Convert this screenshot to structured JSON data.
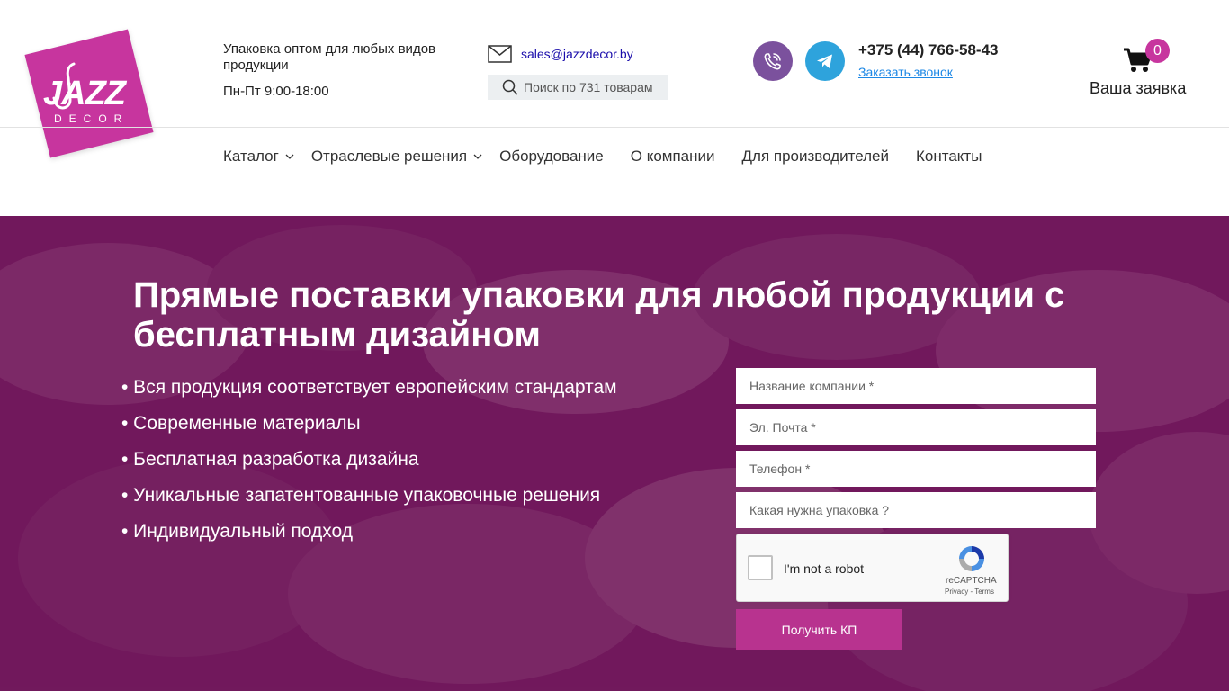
{
  "brand": {
    "logo_text": "JAZZ",
    "logo_subtext": "DECOR",
    "logo_color": "#c7359e"
  },
  "header": {
    "tagline": "Упаковка оптом для любых видов продукции",
    "hours": "Пн-Пт 9:00-18:00",
    "email": "sales@jazzdecor.by",
    "search_placeholder": "Поиск по 731 товарам",
    "phone": "+375 (44) 766-58-43",
    "callback_label": "Заказать звонок",
    "cart_count": "0",
    "cart_label": "Ваша заявка",
    "messengers": [
      "viber-icon",
      "telegram-icon"
    ]
  },
  "nav": {
    "items": [
      {
        "label": "Каталог",
        "has_dropdown": true
      },
      {
        "label": "Отраслевые решения",
        "has_dropdown": true
      },
      {
        "label": "Оборудование",
        "has_dropdown": false
      },
      {
        "label": "О компании",
        "has_dropdown": false
      },
      {
        "label": "Для производителей",
        "has_dropdown": false
      },
      {
        "label": "Контакты",
        "has_dropdown": false
      }
    ]
  },
  "hero": {
    "title": "Прямые поставки упаковки для любой продукции с бесплатным дизайном",
    "benefits": [
      "• Вся продукция соответствует европейским стандартам",
      "• Современные материалы",
      "• Бесплатная разработка дизайна",
      "• Уникальные запатентованные упаковочные решения",
      "• Индивидуальный подход"
    ],
    "overlay_color": "#6e1359"
  },
  "form": {
    "company_placeholder": "Название компании *",
    "email_placeholder": "Эл. Почта *",
    "phone_placeholder": "Телефон *",
    "packaging_placeholder": "Какая нужна упаковка ?",
    "captcha_label": "I'm not a robot",
    "captcha_brand": "reCAPTCHA",
    "captcha_terms": "Privacy - Terms",
    "submit_label": "Получить КП",
    "submit_color": "#b8338f"
  }
}
